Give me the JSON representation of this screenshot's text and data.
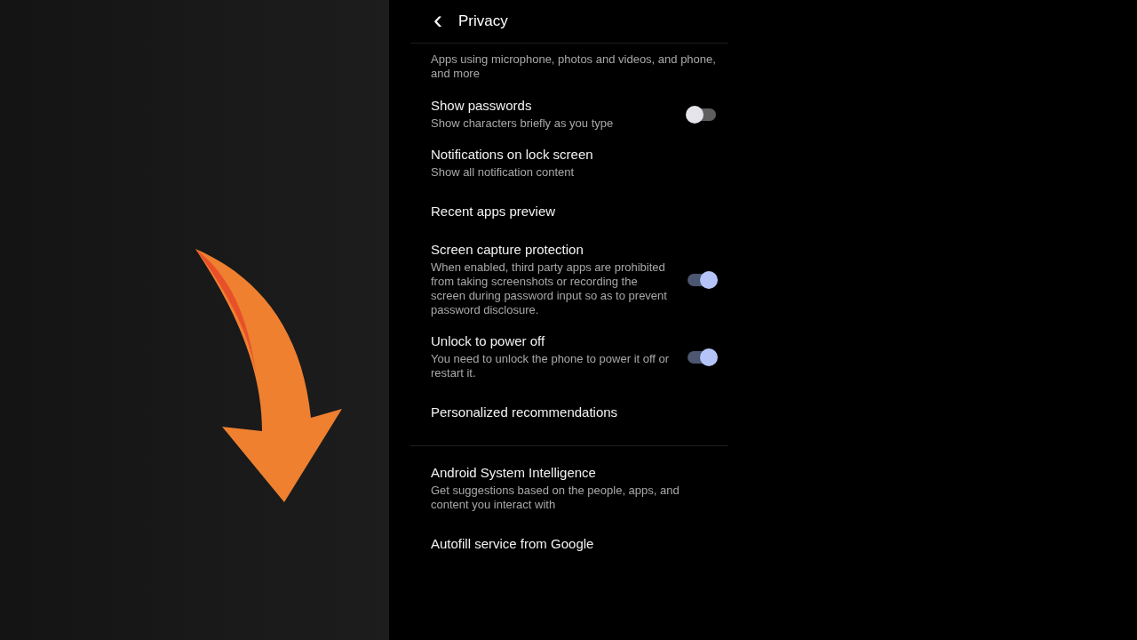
{
  "header": {
    "back": "‹",
    "title": "Privacy"
  },
  "sections": [
    {
      "items": [
        {
          "kind": "plain",
          "subtitle": "Apps using microphone, photos and videos, and phone, and more"
        },
        {
          "kind": "toggle",
          "title": "Show passwords",
          "subtitle": "Show characters briefly as you type",
          "on": false
        },
        {
          "kind": "plain",
          "title": "Notifications on lock screen",
          "subtitle": "Show all notification content"
        },
        {
          "kind": "plain",
          "title": "Recent apps preview"
        },
        {
          "kind": "toggle",
          "title": "Screen capture protection",
          "subtitle": "When enabled, third party apps are prohibited from taking screenshots or recording the screen during password input so as to prevent password disclosure.",
          "on": true
        },
        {
          "kind": "toggle",
          "title": "Unlock to power off",
          "subtitle": "You need to unlock the phone to power it off or restart it.",
          "on": true
        },
        {
          "kind": "plain",
          "title": "Personalized recommendations"
        }
      ]
    },
    {
      "items": [
        {
          "kind": "plain",
          "title": "Android System Intelligence",
          "subtitle": "Get suggestions based on the people, apps, and content you interact with"
        },
        {
          "kind": "plain",
          "title": "Autofill service from Google"
        }
      ]
    }
  ]
}
